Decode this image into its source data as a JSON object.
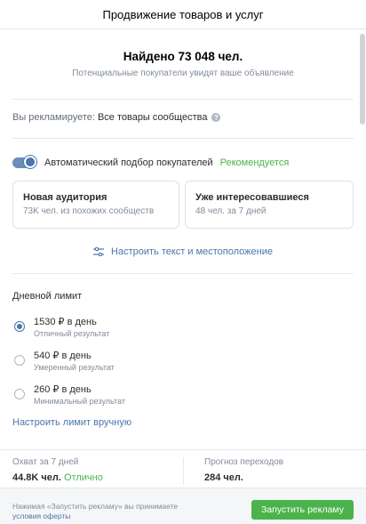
{
  "header": {
    "title": "Продвижение товаров и услуг"
  },
  "audience": {
    "found": "Найдено 73 048 чел.",
    "subtitle": "Потенциальные покупатели увидят ваше объявление"
  },
  "promo": {
    "label": "Вы рекламируете:",
    "value": "Все товары сообщества",
    "help_icon": "?"
  },
  "auto_select": {
    "label": "Автоматический подбор покупателей",
    "badge": "Рекомендуется",
    "enabled": true
  },
  "cards": [
    {
      "title": "Новая аудитория",
      "subtitle": "73K чел. из похожих сообществ"
    },
    {
      "title": "Уже интересовавшиеся",
      "subtitle": "48 чел. за 7 дней"
    }
  ],
  "settings_link": "Настроить текст и местоположение",
  "daily_limit": {
    "title": "Дневной лимит",
    "options": [
      {
        "label": "1530 ₽ в день",
        "sub": "Отличный результат",
        "checked": true
      },
      {
        "label": "540 ₽ в день",
        "sub": "Умеренный результат",
        "checked": false
      },
      {
        "label": "260 ₽ в день",
        "sub": "Минимальный результат",
        "checked": false
      }
    ],
    "manual_link": "Настроить лимит вручную"
  },
  "stats": {
    "reach_label": "Охват за 7 дней",
    "reach_value": "44.8K чел.",
    "reach_rating": "Отлично",
    "clicks_label": "Прогноз переходов",
    "clicks_value": "284 чел."
  },
  "footer": {
    "agree_text": "Нажимая «Запустить рекламу» вы принимаете",
    "agree_link": "условия оферты",
    "launch_label": "Запустить рекламу"
  },
  "colors": {
    "accent": "#4a76a8",
    "green": "#4bb34b",
    "muted": "#818c99"
  }
}
